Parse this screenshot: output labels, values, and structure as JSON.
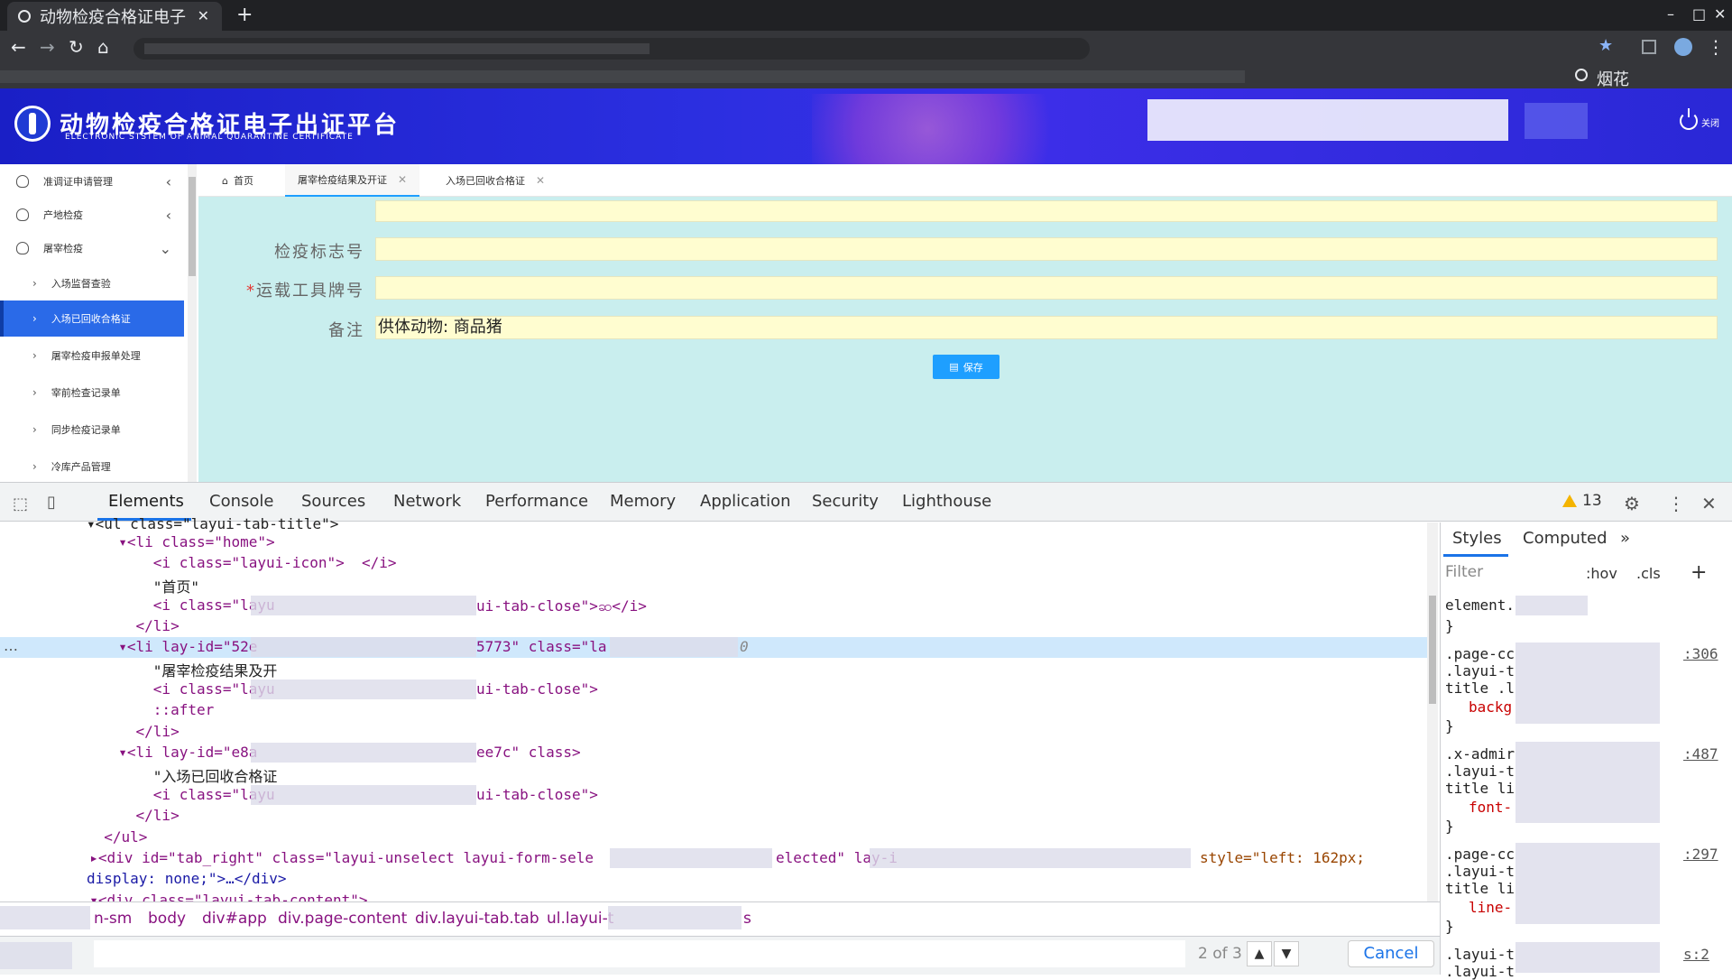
{
  "browser": {
    "tab_title": "动物检疫合格证电子",
    "new_tab": "+",
    "bookmark_label": "烟花",
    "window_controls": [
      "–",
      "□",
      "✕"
    ]
  },
  "site": {
    "title": "动物检疫合格证电子出证平台",
    "subtitle": "ELECTRONIC STSTEM OF ANIMAL QUARANTINE CERTIFICATE",
    "logout": "关闭"
  },
  "sidebar": {
    "groups": [
      {
        "label": "准调证申请管理",
        "icon": "user-icon",
        "chevron": "‹"
      },
      {
        "label": "产地检疫",
        "icon": "user-icon",
        "chevron": "‹"
      },
      {
        "label": "屠宰检疫",
        "icon": "user-icon",
        "chevron": "⌄"
      }
    ],
    "subitems": [
      {
        "label": "入场监督查验"
      },
      {
        "label": "入场已回收合格证"
      },
      {
        "label": "屠宰检疫申报单处理"
      },
      {
        "label": "宰前检查记录单"
      },
      {
        "label": "同步检疫记录单"
      },
      {
        "label": "冷库产品管理"
      }
    ]
  },
  "tabs": [
    {
      "label": "首页"
    },
    {
      "label": "屠宰检疫结果及开证",
      "close": "✕"
    },
    {
      "label": "入场已回收合格证",
      "close": "✕"
    }
  ],
  "form": {
    "fields": [
      {
        "label": "检疫标志号",
        "value": "",
        "required": false
      },
      {
        "label": "运载工具牌号",
        "value": "",
        "required": true
      },
      {
        "label": "备注",
        "value": "供体动物: 商品猪",
        "required": false
      }
    ],
    "required_mark": "*",
    "save_label": "保存"
  },
  "devtools": {
    "tabs": [
      "Elements",
      "Console",
      "Sources",
      "Network",
      "Performance",
      "Memory",
      "Application",
      "Security",
      "Lighthouse"
    ],
    "warning_count": "13",
    "styles_tabs": [
      "Styles",
      "Computed",
      "»"
    ],
    "filter_placeholder": "Filter",
    "hov": ":hov",
    "cls": ".cls",
    "plus": "+",
    "search_count": "2 of 3",
    "cancel": "Cancel",
    "breadcrumbs": [
      "n-sm",
      "body",
      "div#app",
      "div.page-content",
      "div.layui-tab.tab",
      "ul.layui-t",
      "s"
    ],
    "ellipsis": "…",
    "code_lines": [
      "▾<ul class=\"layui-tab-title\">",
      "  ▾<li class=\"home\">",
      "      <i class=\"layui-icon\">  </i>",
      "      \"首页\"",
      "      <i class=\"layu",
      "ui-tab-close\">ဆ</i>",
      "    </li>",
      "  ▾<li lay-id=\"52e",
      "5773\" class=\"la",
      "0",
      "      \"屠宰检疫结果及开",
      "      <i class=\"layu",
      "ui-tab-close\">",
      "      ::after",
      "    </li>",
      "  ▾<li lay-id=\"e8a",
      "ee7c\" class>",
      "      \"入场已回收合格证",
      "      <i class=\"layu",
      "ui-tab-close\">",
      "    </li>",
      "  </ul>",
      "  ▸<div id=\"tab_right\" class=\"layui-unselect layui-form-sele",
      "elected\" lay-i",
      "style=\"left: 162px;",
      "display: none;\">…</div>",
      "  ▾<div class=\"layui-tab-content\">"
    ],
    "style_lines": [
      "element.",
      "}",
      ".page-cc",
      ".layui-t",
      "title .l",
      "backg",
      "}",
      ".x-admir",
      ".layui-t",
      "title li",
      "font-",
      "}",
      ".page-cc",
      ".layui-t",
      "title li",
      "line-",
      "}",
      ".layui-t",
      ".layui-t"
    ],
    "style_links": [
      ":306",
      ":487",
      ":297",
      "s:2"
    ]
  }
}
